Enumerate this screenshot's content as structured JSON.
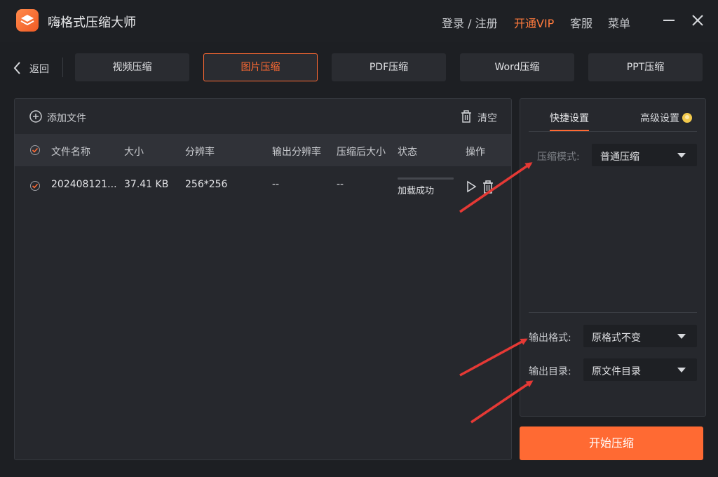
{
  "app": {
    "title": "嗨格式压缩大师"
  },
  "header": {
    "login": "登录 / 注册",
    "vip": "开通VIP",
    "support": "客服",
    "menu": "菜单"
  },
  "nav": {
    "back": "返回",
    "tabs": [
      {
        "label": "视频压缩"
      },
      {
        "label": "图片压缩",
        "active": true
      },
      {
        "label": "PDF压缩"
      },
      {
        "label": "Word压缩"
      },
      {
        "label": "PPT压缩"
      }
    ]
  },
  "file_panel": {
    "add_file": "添加文件",
    "clear": "清空",
    "columns": [
      "文件名称",
      "大小",
      "分辨率",
      "输出分辨率",
      "压缩后大小",
      "状态",
      "操作"
    ],
    "rows": [
      {
        "name": "202408121...",
        "size": "37.41 KB",
        "resolution": "256*256",
        "output_resolution": "--",
        "compressed_size": "--",
        "status": "加载成功"
      }
    ]
  },
  "settings": {
    "tab_quick": "快捷设置",
    "tab_advanced": "高级设置",
    "mode_label": "压缩模式:",
    "mode_value": "普通压缩",
    "format_label": "输出格式:",
    "format_value": "原格式不变",
    "dir_label": "输出目录:",
    "dir_value": "原文件目录"
  },
  "start_button": "开始压缩",
  "colors": {
    "accent": "#ff6a33",
    "background": "#1d1f23",
    "panel": "#26282d",
    "annotation_arrow": "#e53935"
  },
  "icons": {
    "logo": "layers-icon",
    "minimize": "minimize-icon",
    "close": "close-icon",
    "back": "chevron-left-icon",
    "add": "plus-circle-icon",
    "clear": "trash-icon",
    "play": "play-icon",
    "delete": "trash-icon",
    "help": "help-icon"
  }
}
